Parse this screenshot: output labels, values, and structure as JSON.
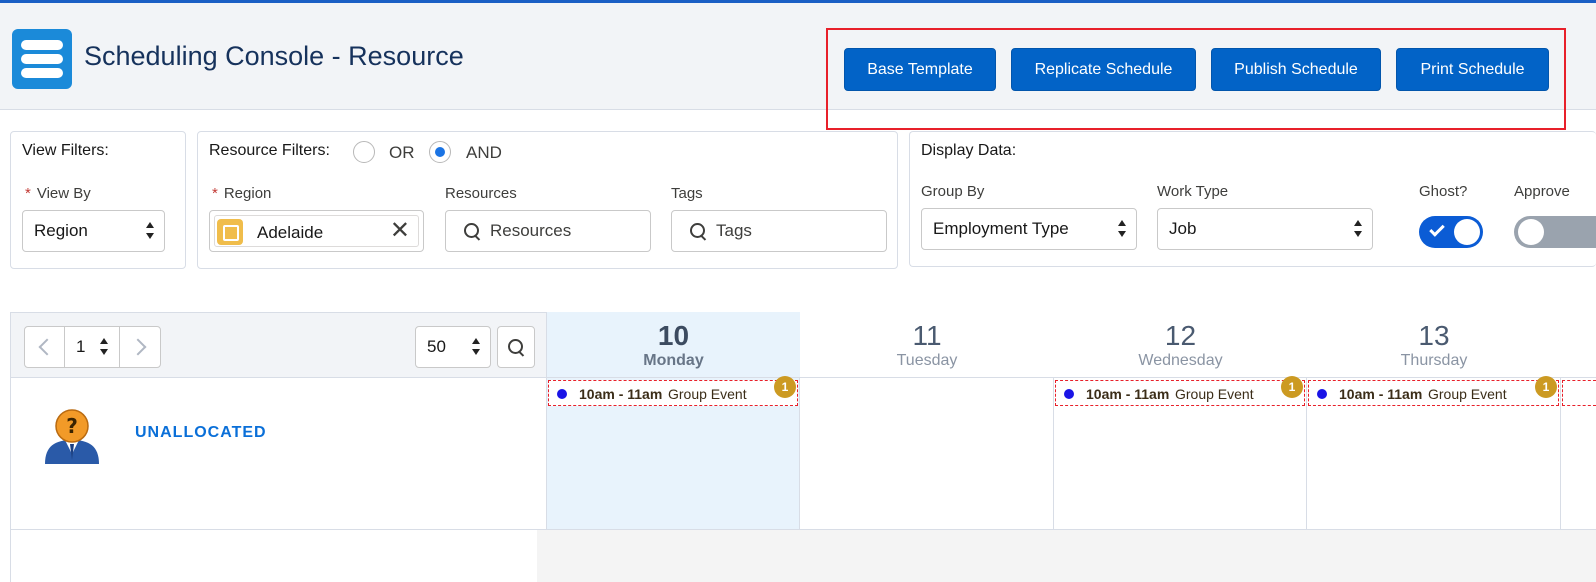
{
  "header": {
    "title": "Scheduling Console - Resource",
    "buttons": {
      "base_template": "Base Template",
      "replicate_schedule": "Replicate Schedule",
      "publish_schedule": "Publish Schedule",
      "print_schedule": "Print Schedule"
    }
  },
  "view_filters": {
    "title": "View Filters:",
    "view_by_label": "View By",
    "view_by_value": "Region"
  },
  "resource_filters": {
    "title": "Resource Filters:",
    "or_label": "OR",
    "and_label": "AND",
    "selected_mode": "AND",
    "region_label": "Region",
    "region_value": "Adelaide",
    "resources_label": "Resources",
    "resources_placeholder": "Resources",
    "tags_label": "Tags",
    "tags_placeholder": "Tags"
  },
  "display_data": {
    "title": "Display Data:",
    "group_by_label": "Group By",
    "group_by_value": "Employment Type",
    "work_type_label": "Work Type",
    "work_type_value": "Job",
    "ghost_label": "Ghost?",
    "ghost_on": true,
    "approve_label": "Approve",
    "approve_on": false
  },
  "pager": {
    "page": "1",
    "page_size": "50"
  },
  "days": [
    {
      "num": "10",
      "name": "Monday",
      "selected": true
    },
    {
      "num": "11",
      "name": "Tuesday",
      "selected": false
    },
    {
      "num": "12",
      "name": "Wednesday",
      "selected": false
    },
    {
      "num": "13",
      "name": "Thursday",
      "selected": false
    }
  ],
  "row": {
    "label": "UNALLOCATED",
    "events": {
      "monday": {
        "time": "10am - 11am",
        "name": "Group Event",
        "count": "1"
      },
      "wednesday": {
        "time": "10am - 11am",
        "name": "Group Event",
        "count": "1"
      },
      "thursday": {
        "time": "10am - 11am",
        "name": "Group Event",
        "count": "1"
      }
    }
  },
  "colors": {
    "brand": "#0263c7",
    "highlight_outline": "#e8202a",
    "selected_day": "#e8f3fc",
    "event_badge": "#cc9a22"
  }
}
